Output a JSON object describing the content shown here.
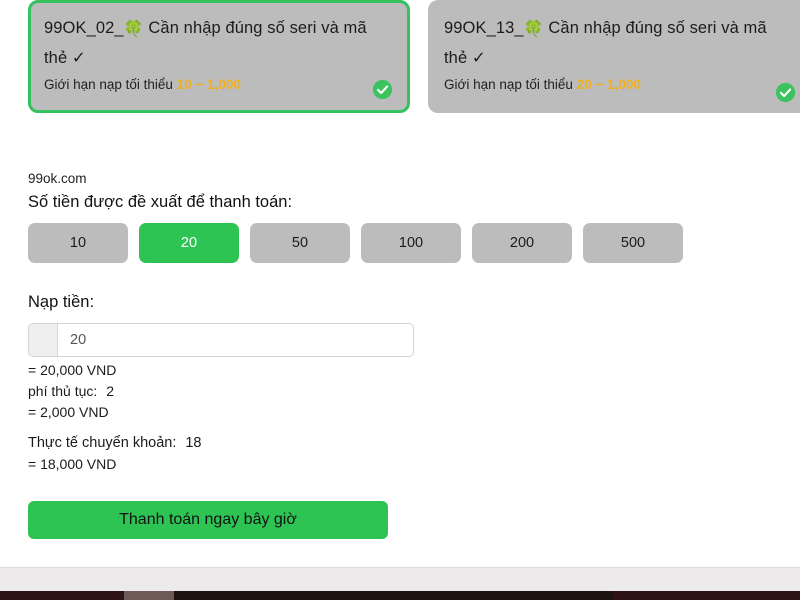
{
  "cards": [
    {
      "id": "card-99ok-02",
      "code": "99OK_02_",
      "icon": "four-leaf-clover-icon",
      "icon_glyph": "🍀",
      "title": " Cần nhập đúng số seri và mã thẻ ✓",
      "limit_label": "Giới hạn nạp tối thiểu ",
      "limit_value": "10 ~ 1,000",
      "selected": true,
      "badge": "check-circle-icon"
    },
    {
      "id": "card-99ok-13",
      "code": "99OK_13_",
      "icon": "four-leaf-clover-icon",
      "icon_glyph": "🍀",
      "title": " Cần nhập đúng số seri và mã thẻ ✓",
      "limit_label": "Giới hạn nạp tối thiểu ",
      "limit_value": "20 ~ 1,000",
      "selected": false,
      "badge": "check-circle-icon"
    }
  ],
  "form": {
    "site_name": "99ok.com",
    "suggest_label": "Số tiền được đề xuất để thanh toán:",
    "chips": [
      {
        "label": "10",
        "active": false
      },
      {
        "label": "20",
        "active": true
      },
      {
        "label": "50",
        "active": false
      },
      {
        "label": "100",
        "active": false
      },
      {
        "label": "200",
        "active": false
      },
      {
        "label": "500",
        "active": false
      }
    ],
    "deposit_label": "Nạp tiền:",
    "amount_value": "20",
    "amount_placeholder": "20",
    "lines": {
      "amount_vnd": "= 20,000 VND",
      "fee_label": "phí thủ tục:",
      "fee_value": "2",
      "fee_vnd": "= 2,000 VND",
      "actual_label": "Thực tế chuyển khoản:",
      "actual_value": "18",
      "actual_vnd": "= 18,000 VND"
    },
    "pay_button": "Thanh toán ngay bây giờ"
  },
  "colors": {
    "accent_green": "#2ec454",
    "card_grey": "#bcbcbc",
    "limit_orange": "#f0b01a",
    "badge_green": "#3cc35e"
  }
}
